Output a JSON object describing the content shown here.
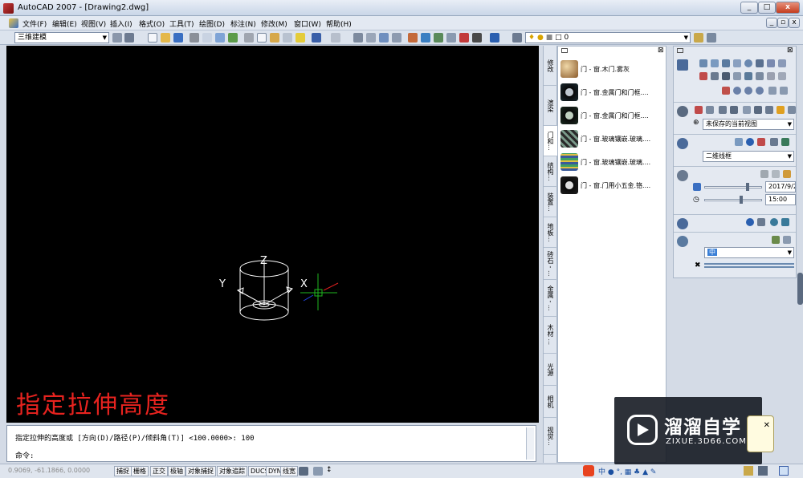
{
  "window": {
    "title": "AutoCAD 2007 - [Drawing2.dwg]",
    "min": "_",
    "max": "□",
    "close": "x",
    "doc_min": "_",
    "doc_max": "▫",
    "doc_close": "x"
  },
  "menu": [
    "文件(F)",
    "编辑(E)",
    "视图(V)",
    "插入(I)",
    "格式(O)",
    "工具(T)",
    "绘图(D)",
    "标注(N)",
    "修改(M)",
    "窗口(W)",
    "帮助(H)"
  ],
  "toolbar": {
    "workspace": "三维建模",
    "layer_value": "0"
  },
  "canvas": {
    "prompt": "指定拉伸高度",
    "axis_z": "Z",
    "axis_y": "Y",
    "axis_x": "X",
    "colors": {
      "background": "#000000",
      "prompt": "#e8231f",
      "wireframe": "#ffffff"
    }
  },
  "command": {
    "history": "指定拉伸的高度或 [方向(D)/路径(P)/倾斜角(T)] <100.0000>: 100",
    "prompt": "命令:"
  },
  "status": {
    "coords": "0.9069,  -61.1866, 0.0000",
    "buttons": [
      "捕捉",
      "栅格",
      "正交",
      "极轴",
      "对象捕捉",
      "对象追踪",
      "DUCS",
      "DYN",
      "线宽"
    ]
  },
  "tool_palette": {
    "tabs": [
      "修改",
      "渲染",
      "门和...",
      "结构...",
      "装置...",
      "地板...",
      "砖石 - ...",
      "金属 - ...",
      "木材 ...",
      "光源",
      "相机",
      "视觉..."
    ],
    "active_tab": 2,
    "materials": [
      {
        "label": "门 - 窗.木门.雾灰",
        "color": "#c49a5a"
      },
      {
        "label": "门 - 窗.金属门和门框....",
        "color": "#3a6a8a"
      },
      {
        "label": "门 - 窗.金属门和门框....",
        "color": "#4c7a55"
      },
      {
        "label": "门 - 窗.玻璃镶嵌.玻璃....",
        "color": "#7a4a8a"
      },
      {
        "label": "门 - 窗.玻璃镶嵌.玻璃....",
        "color": "#5a8ab0"
      },
      {
        "label": "门 - 窗.门用小五金.铬....",
        "color": "#8a8a8a"
      }
    ]
  },
  "dashboard": {
    "view_select": "未保存的当前视图",
    "visual_style": "二维线框",
    "date": "2017/9/2",
    "time": "15:00",
    "material_mode": "中"
  },
  "watermark": {
    "brand": "溜溜自学",
    "url": "ZIXUE.3D66.COM"
  }
}
